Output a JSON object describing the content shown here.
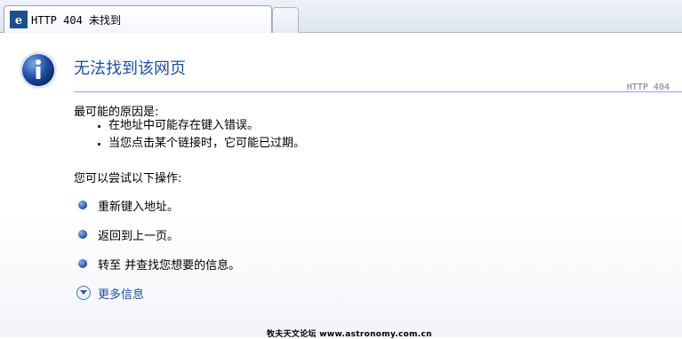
{
  "tab": {
    "title": "HTTP 404 未找到",
    "icon": "ie-page-icon"
  },
  "page": {
    "title": "无法找到该网页",
    "http_code": "HTTP 404",
    "cause_heading": "最可能的原因是:",
    "causes": [
      "在地址中可能存在键入错误。",
      "当您点击某个链接时，它可能已过期。"
    ],
    "try_heading": "您可以尝试以下操作:",
    "actions": [
      "重新键入地址。",
      "返回到上一页。",
      "转至  并查找您想要的信息。"
    ],
    "more_info": "更多信息"
  },
  "watermark": "牧夫天文论坛 www.astronomy.com.cn",
  "colors": {
    "title": "#1f4e9a",
    "rule": "#8aa6cf",
    "accent": "#1d4f9f"
  }
}
